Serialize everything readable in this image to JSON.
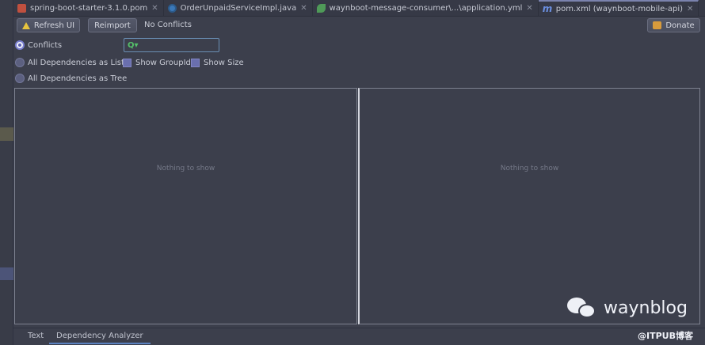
{
  "tabs": [
    {
      "label": "spring-boot-starter-3.1.0.pom",
      "icon": "maven-file-icon"
    },
    {
      "label": "OrderUnpaidServiceImpl.java",
      "icon": "java-class-icon"
    },
    {
      "label": "waynboot-message-consumer\\...\\application.yml",
      "icon": "yml-file-icon"
    },
    {
      "label": "pom.xml (waynboot-mobile-api)",
      "icon": "maven-m-icon"
    }
  ],
  "toolbar": {
    "refresh_label": "Refresh UI",
    "reimport_label": "Reimport",
    "status": "No Conflicts",
    "donate_label": "Donate"
  },
  "options": {
    "conflicts": "Conflicts",
    "as_list": "All Dependencies as List",
    "as_tree": "All Dependencies as Tree",
    "show_groupid": "Show GroupId",
    "show_size": "Show Size",
    "selected": "conflicts"
  },
  "search": {
    "placeholder": ""
  },
  "panels": {
    "left_empty": "Nothing to show",
    "right_empty": "Nothing to show"
  },
  "bottom_tabs": {
    "text": "Text",
    "dependency_analyzer": "Dependency Analyzer",
    "active": "dependency_analyzer"
  },
  "watermark": {
    "brand": "waynblog",
    "source": "@ITPUB博客"
  },
  "colors": {
    "background": "#3c3f4c",
    "accent": "#5b82c0",
    "warning": "#e7c43e"
  }
}
